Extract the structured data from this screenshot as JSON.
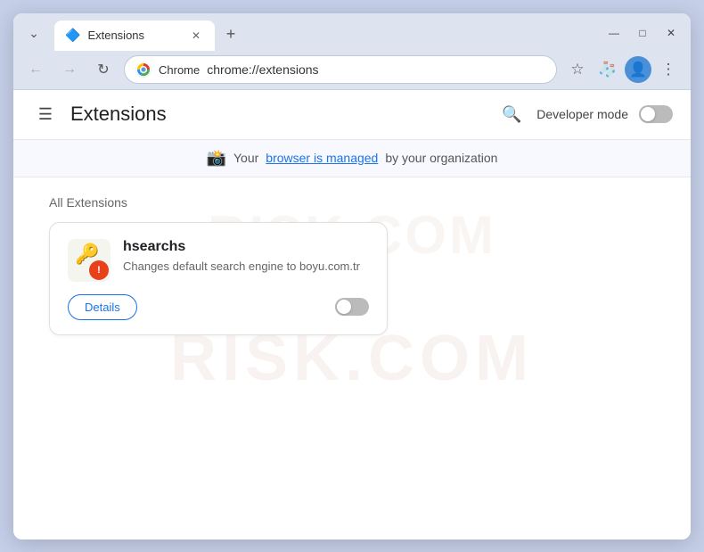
{
  "browser": {
    "tab": {
      "icon": "🔷",
      "label": "Extensions",
      "url": "chrome://extensions"
    },
    "brand": "Chrome",
    "address": "chrome://extensions",
    "window_controls": {
      "minimize": "—",
      "maximize": "□",
      "close": "✕"
    }
  },
  "nav": {
    "back_disabled": true,
    "forward_disabled": true
  },
  "extensions_page": {
    "title": "Extensions",
    "developer_mode_label": "Developer mode",
    "developer_mode_on": false,
    "managed_notice": "Your",
    "managed_link": "browser is managed",
    "managed_suffix": "by your organization",
    "section_title": "All Extensions"
  },
  "extension": {
    "name": "hsearchs",
    "description": "Changes default search engine to boyu.com.tr",
    "details_button": "Details",
    "enabled": false
  },
  "watermark": {
    "line1": "RISK.COM"
  }
}
